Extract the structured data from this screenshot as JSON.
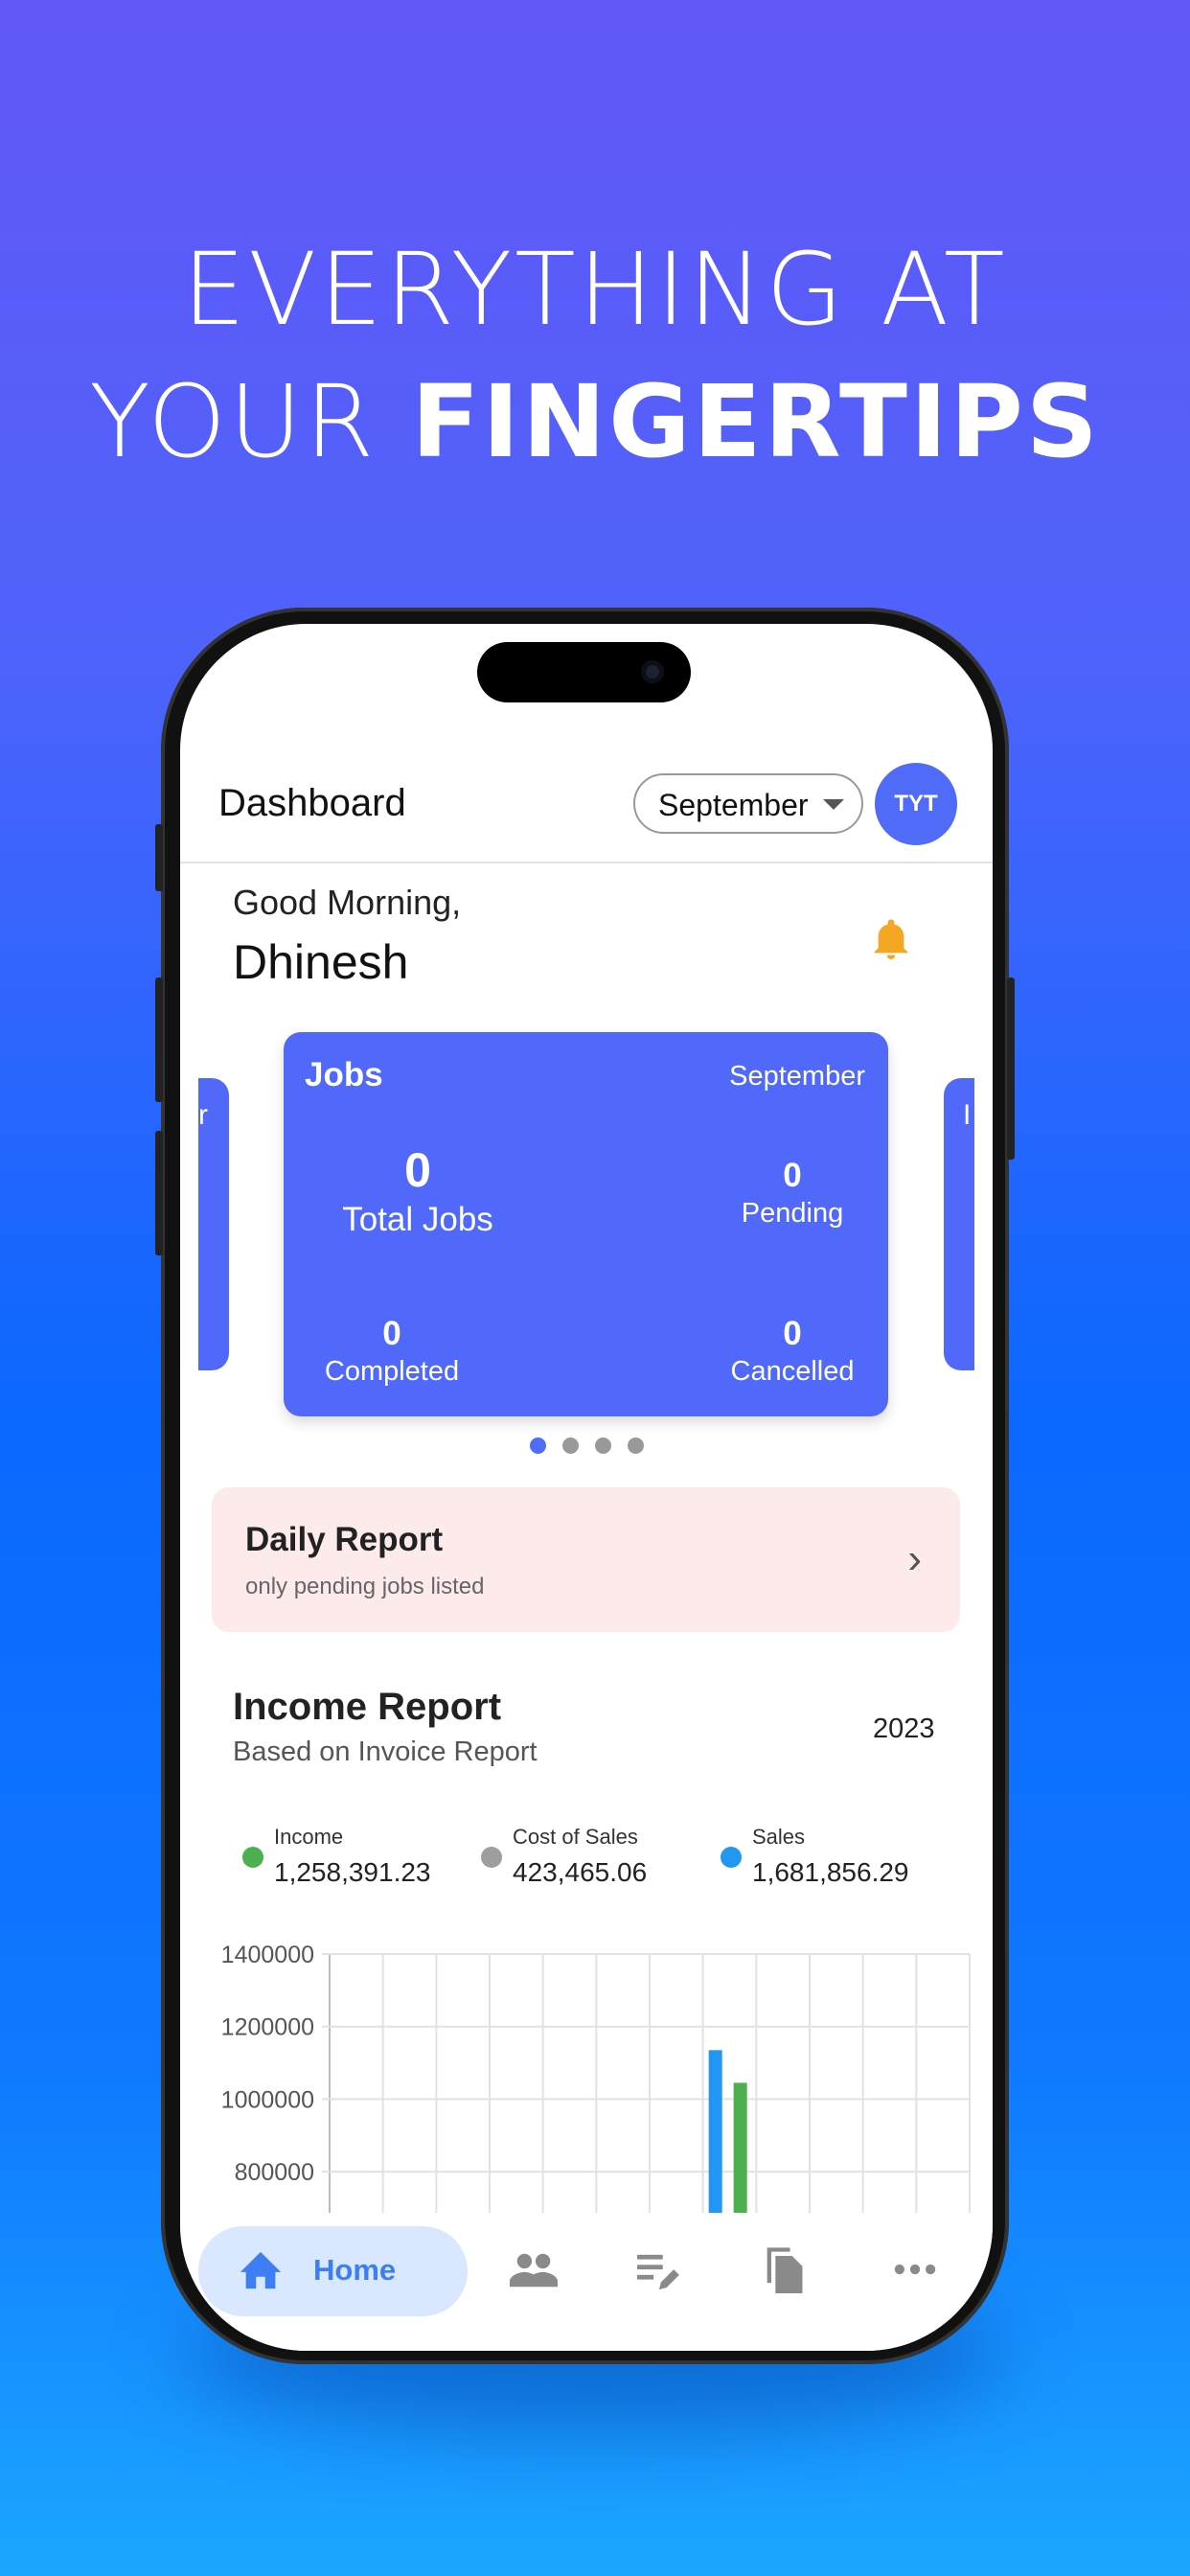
{
  "headline": {
    "line1": "EVERYTHING AT",
    "line2_regular": "YOUR ",
    "line2_bold": "FINGERTIPS"
  },
  "header": {
    "title": "Dashboard",
    "month_select": "September",
    "avatar_initials": "TYT"
  },
  "greeting": {
    "salutation": "Good Morning,",
    "name": "Dhinesh",
    "icon": "bell-icon"
  },
  "jobs_card": {
    "title": "Jobs",
    "month": "September",
    "total": {
      "value": "0",
      "label": "Total Jobs"
    },
    "pending": {
      "value": "0",
      "label": "Pending"
    },
    "completed": {
      "value": "0",
      "label": "Completed"
    },
    "cancelled": {
      "value": "0",
      "label": "Cancelled"
    },
    "left_peek": "r",
    "right_peek": "I"
  },
  "carousel": {
    "pages": 4,
    "active": 0
  },
  "daily_report": {
    "title": "Daily Report",
    "subtitle": "only pending jobs listed"
  },
  "income_report": {
    "title": "Income Report",
    "subtitle": "Based on Invoice Report",
    "year": "2023",
    "legend": [
      {
        "label": "Income",
        "value": "1,258,391.23",
        "color": "#4caf50"
      },
      {
        "label": "Cost of Sales",
        "value": "423,465.06",
        "color": "#9e9e9e"
      },
      {
        "label": "Sales",
        "value": "1,681,856.29",
        "color": "#2196f3"
      }
    ]
  },
  "chart_data": {
    "type": "bar",
    "yticks": [
      "1400000",
      "1200000",
      "1000000",
      "800000"
    ],
    "ylim": [
      700000,
      1400000
    ],
    "grid": true,
    "columns": 12,
    "series": [
      {
        "name": "Sales",
        "color": "#2196f3",
        "values": [
          0,
          0,
          0,
          0,
          0,
          0,
          0,
          1135000,
          0,
          0,
          0,
          0
        ]
      },
      {
        "name": "Income",
        "color": "#4caf50",
        "values": [
          0,
          0,
          0,
          0,
          0,
          0,
          0,
          1045000,
          0,
          0,
          0,
          0
        ]
      }
    ]
  },
  "nav": {
    "items": [
      {
        "label": "Home",
        "icon": "home-icon",
        "active": true
      },
      {
        "icon": "people-icon"
      },
      {
        "icon": "edit-list-icon"
      },
      {
        "icon": "documents-icon"
      },
      {
        "icon": "more-icon"
      }
    ]
  }
}
